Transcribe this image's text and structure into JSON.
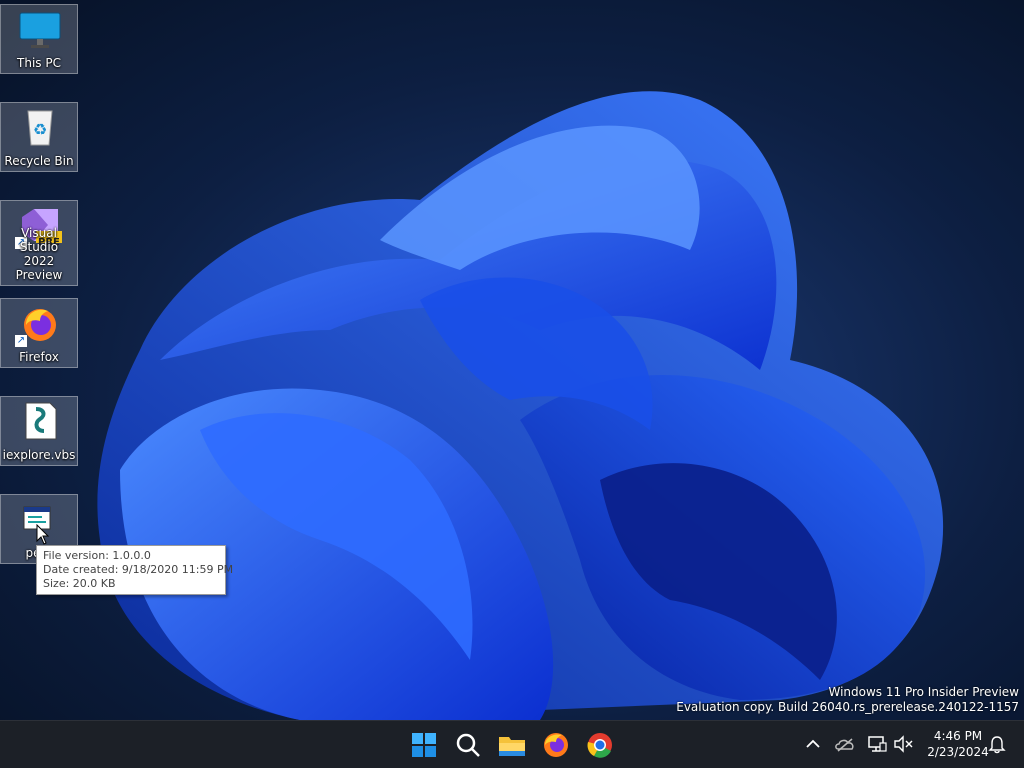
{
  "desktop": {
    "icons": [
      {
        "label": "This PC",
        "icon": "this-pc-icon"
      },
      {
        "label": "Recycle Bin",
        "icon": "recycle-bin-icon"
      },
      {
        "label": "Visual Studio\n2022 Preview",
        "icon": "visual-studio-icon",
        "badge": "PRE"
      },
      {
        "label": "Firefox",
        "icon": "firefox-icon"
      },
      {
        "label": "iexplore.vbs",
        "icon": "vbs-script-icon"
      },
      {
        "label": "pete",
        "icon": "application-icon"
      }
    ]
  },
  "tooltip": {
    "file_version": "File version: 1.0.0.0",
    "date_created": "Date created: 9/18/2020 11:59 PM",
    "size": "Size: 20.0 KB"
  },
  "watermark": {
    "line1": "Windows 11 Pro Insider Preview",
    "line2": "Evaluation copy. Build 26040.rs_prerelease.240122-1157"
  },
  "taskbar": {
    "pinned": [
      "start-icon",
      "search-icon",
      "file-explorer-icon",
      "firefox-icon",
      "chrome-icon"
    ],
    "tray": [
      "chevron-up-icon",
      "onedrive-icon",
      "network-icon",
      "volume-muted-icon",
      "notification-bell-icon"
    ],
    "clock": {
      "time": "4:46 PM",
      "date": "2/23/2024"
    }
  },
  "colors": {
    "taskbar": "#1c2027",
    "wallpaper_bg": "#0a1a33",
    "bloom": "#1f5fff"
  }
}
